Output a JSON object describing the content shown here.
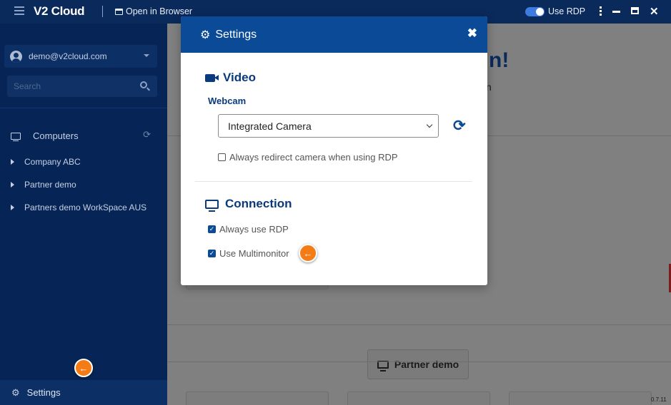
{
  "topbar": {
    "brand": "V2 Cloud",
    "open_in_browser": "Open in Browser",
    "use_rdp": "Use RDP"
  },
  "sidebar": {
    "account_email": "demo@v2cloud.com",
    "search_placeholder": "Search",
    "computers_label": "Computers",
    "groups": [
      {
        "label": "Company ABC"
      },
      {
        "label": "Partner demo"
      },
      {
        "label": "Partners demo WorkSpace AUS"
      }
    ],
    "settings_label": "Settings"
  },
  "background": {
    "heading_fragment": "n!",
    "text_fragment": "n",
    "partner_button": "Partner demo",
    "version": "0.7.11"
  },
  "modal": {
    "title": "Settings",
    "video": {
      "title": "Video",
      "webcam_label": "Webcam",
      "webcam_selected": "Integrated Camera",
      "redirect_camera_label": "Always redirect camera when using RDP",
      "redirect_camera_checked": false
    },
    "connection": {
      "title": "Connection",
      "always_rdp_label": "Always use RDP",
      "always_rdp_checked": true,
      "multimonitor_label": "Use Multimonitor",
      "multimonitor_checked": true
    }
  },
  "colors": {
    "topbar": "#0a2a5c",
    "sidebar": "#062556",
    "modal_header": "#0a4a96",
    "accent_hint": "#f47b16",
    "section_title": "#0a3a7e"
  },
  "icons": [
    "hamburger-icon",
    "window-icon",
    "toggle",
    "kebab-icon",
    "minimize-icon",
    "maximize-icon",
    "close-icon",
    "avatar-icon",
    "chevron-down-icon",
    "search-icon",
    "monitor-icon",
    "refresh-icon",
    "caret-right-icon",
    "gear-icon",
    "arrow-left-icon",
    "video-camera-icon",
    "sync-icon"
  ]
}
